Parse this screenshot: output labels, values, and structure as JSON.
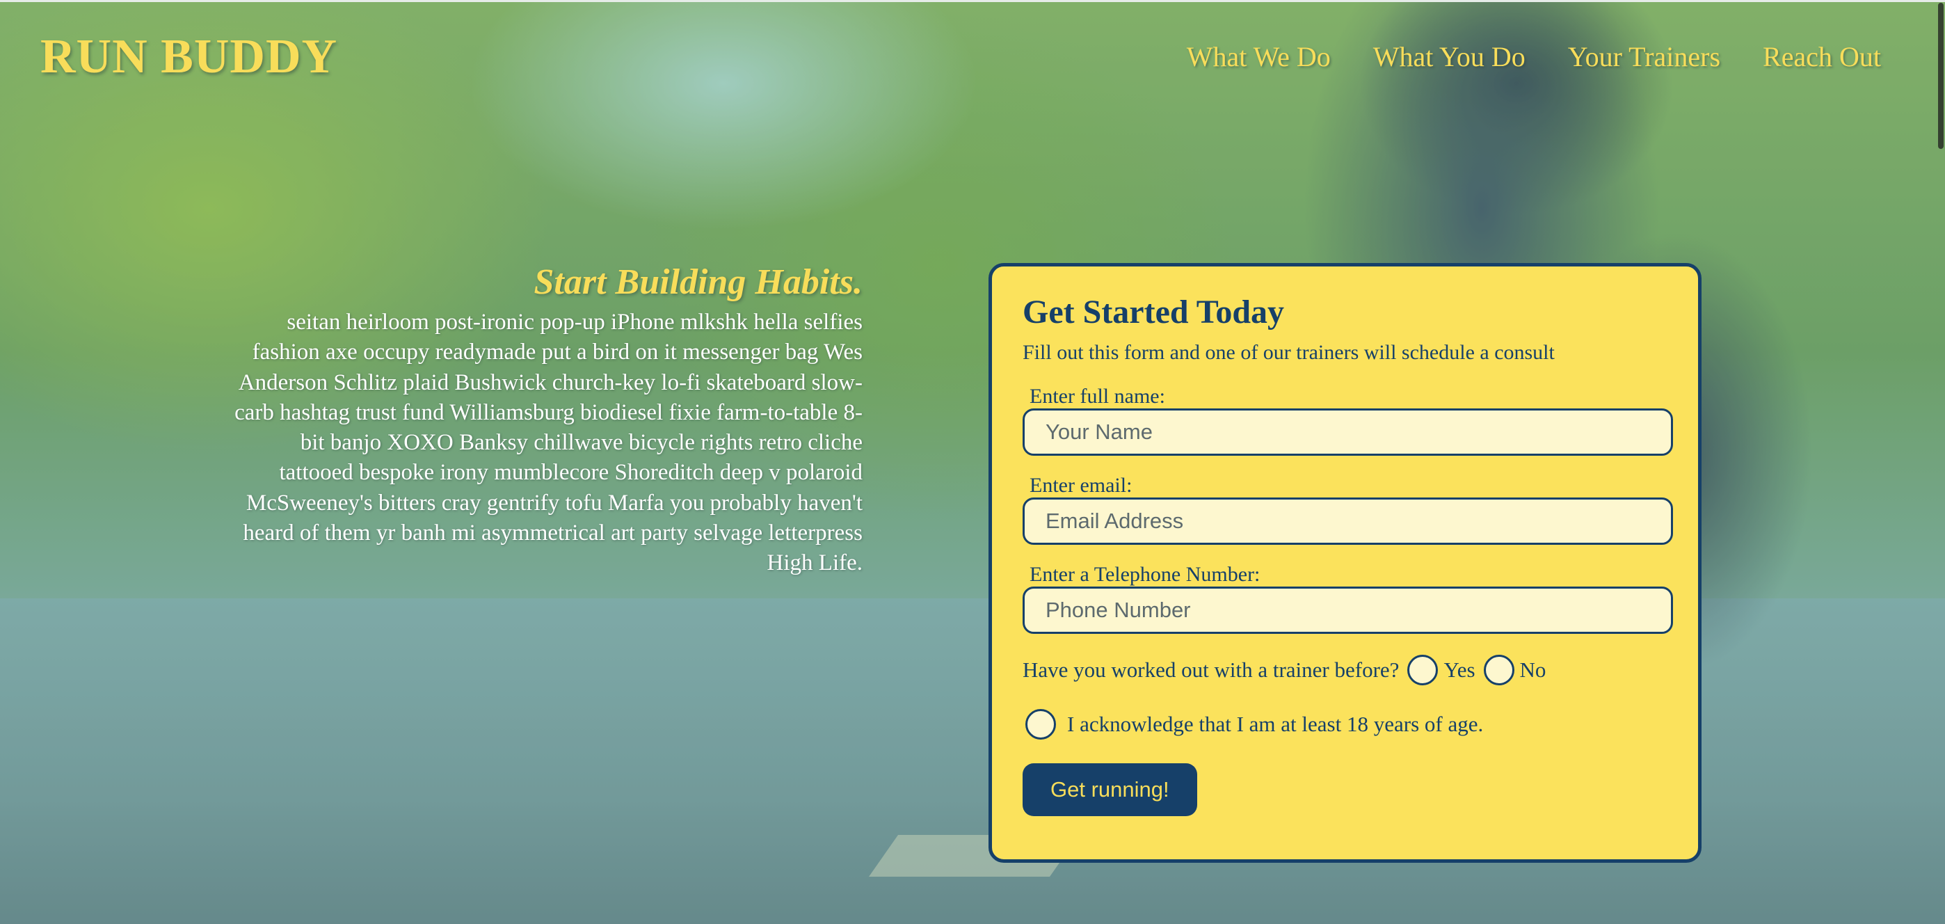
{
  "header": {
    "logo": "RUN BUDDY",
    "nav": [
      {
        "label": "What We Do"
      },
      {
        "label": "What You Do"
      },
      {
        "label": "Your Trainers"
      },
      {
        "label": "Reach Out"
      }
    ]
  },
  "intro": {
    "heading": "Start Building Habits.",
    "body": "seitan heirloom post-ironic pop-up iPhone mlkshk hella selfies fashion axe occupy readymade put a bird on it messenger bag Wes Anderson Schlitz plaid Bushwick church-key lo-fi skateboard slow-carb hashtag trust fund Williamsburg biodiesel fixie farm-to-table 8-bit banjo XOXO Banksy chillwave bicycle rights retro cliche tattooed bespoke irony mumblecore Shoreditch deep v polaroid McSweeney's bitters cray gentrify tofu Marfa you probably haven't heard of them yr banh mi asymmetrical art party selvage letterpress High Life."
  },
  "form": {
    "title": "Get Started Today",
    "subtitle": "Fill out this form and one of our trainers will schedule a consult",
    "name_label": "Enter full name:",
    "name_placeholder": "Your Name",
    "email_label": "Enter email:",
    "email_placeholder": "Email Address",
    "phone_label": "Enter a Telephone Number:",
    "phone_placeholder": "Phone Number",
    "trainer_question": "Have you worked out with a trainer before?",
    "yes_label": "Yes",
    "no_label": "No",
    "age_ack": "I acknowledge that I am at least 18 years of age.",
    "submit_label": "Get running!"
  },
  "colors": {
    "accent_yellow": "#f8dd5a",
    "form_background": "#fbe25c",
    "navy": "#164069",
    "input_background": "#fdf7cf"
  }
}
